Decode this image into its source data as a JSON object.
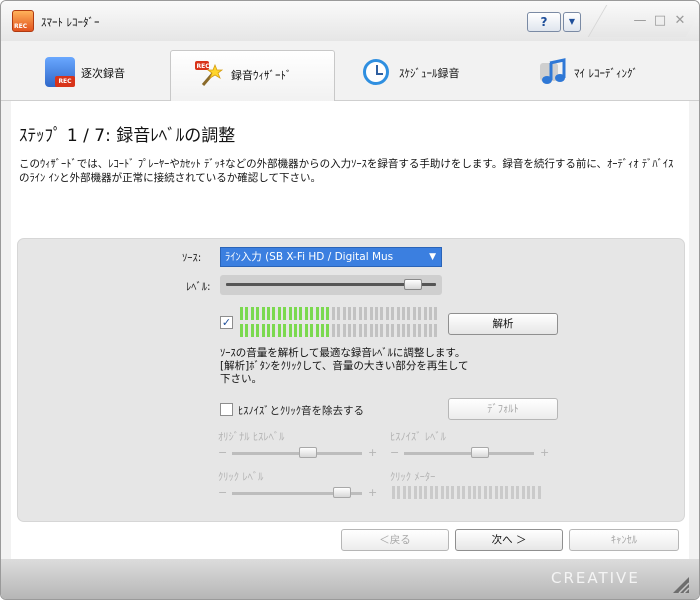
{
  "window": {
    "title": "ｽﾏｰﾄ ﾚｺｰﾀﾞｰ",
    "help_label": "?"
  },
  "tabs": [
    {
      "label": "逐次録音",
      "icon": "rec-music-icon"
    },
    {
      "label": "録音ｳｨｻﾞｰﾄﾞ",
      "icon": "magic-wand-icon"
    },
    {
      "label": "ｽｹｼﾞｭｰﾙ録音",
      "icon": "clock-icon"
    },
    {
      "label": "ﾏｲ ﾚｺｰﾃﾞｨﾝｸﾞ",
      "icon": "music-note-icon"
    }
  ],
  "step": {
    "title": "ｽﾃｯﾌﾟ 1 / 7: 録音ﾚﾍﾞﾙの調整",
    "description": "このｳｨｻﾞｰﾄﾞでは、ﾚｺｰﾄﾞ ﾌﾟﾚｰﾔｰやｶｾｯﾄ ﾃﾞｯｷなどの外部機器からの入力ｿｰｽを録音する手助けをします。録音を続行する前に、ｵｰﾃﾞｨｵ ﾃﾞﾊﾞｲｽのﾗｲﾝ ｲﾝと外部機器が正常に接続されているか確認して下さい。"
  },
  "panel": {
    "source_label": "ｿｰｽ:",
    "source_value": "ﾗｲﾝ入力 (SB X-Fi HD / Digital Mus",
    "level_label": "ﾚﾍﾞﾙ:",
    "level_fraction": 0.92,
    "meter_checked": true,
    "meter_fraction": 0.46,
    "analyze_button": "解析",
    "analyze_description": "ｿｰｽの音量を解析して最適な録音ﾚﾍﾞﾙに調整します。[解析]ﾎﾞﾀﾝをｸﾘｯｸして、音量の大きい部分を再生して下さい。",
    "hiss_checkbox_label": "ﾋｽﾉｲｽﾞとｸﾘｯｸ音を除去する",
    "hiss_checked": false,
    "default_button": "ﾃﾞﾌｫﾙﾄ",
    "original_hiss_label": "ｵﾘｼﾞﾅﾙ ﾋｽﾚﾍﾞﾙ",
    "hiss_noise_label": "ﾋｽﾉｲｽﾞ ﾚﾍﾞﾙ",
    "click_level_label": "ｸﾘｯｸ ﾚﾍﾞﾙ",
    "click_meter_label": "ｸﾘｯｸ ﾒｰﾀｰ",
    "minus": "−",
    "plus": "+",
    "original_hiss_fraction": 0.6,
    "hiss_noise_fraction": 0.6,
    "click_level_fraction": 0.9
  },
  "footer": {
    "back_button": "＜戻る",
    "next_button": "次へ ＞",
    "cancel_button": "ｷｬﾝｾﾙ",
    "brand": "CREATIVE"
  },
  "colors": {
    "accent": "#3b7fe0",
    "meter_on": "#7bd94f"
  }
}
